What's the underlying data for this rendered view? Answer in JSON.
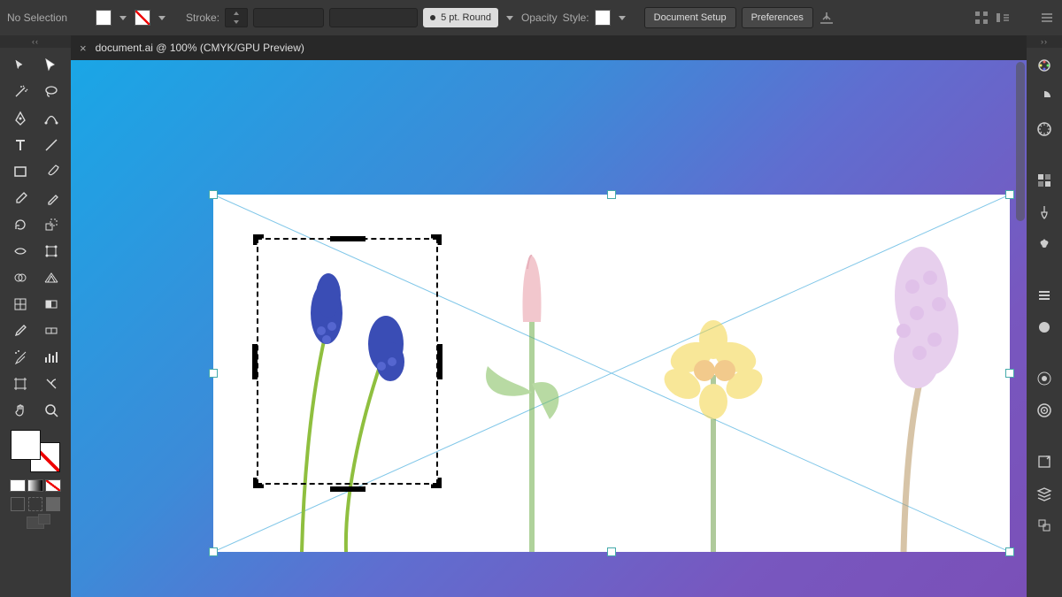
{
  "topbar": {
    "selection_label": "No Selection",
    "stroke_label": "Stroke:",
    "brush_label": "5 pt. Round",
    "opacity_label": "Opacity",
    "style_label": "Style:",
    "doc_setup_label": "Document Setup",
    "preferences_label": "Preferences"
  },
  "tab": {
    "title": "document.ai @ 100% (CMYK/GPU Preview)"
  },
  "colors": {
    "fill": "#ffffff",
    "stroke": "none",
    "canvas_gradient_start": "#1aa6e6",
    "canvas_gradient_end": "#7a50b8"
  },
  "left_tools": [
    "selection-tool",
    "direct-selection-tool",
    "magic-wand-tool",
    "lasso-tool",
    "pen-tool",
    "curvature-tool",
    "type-tool",
    "line-segment-tool",
    "rectangle-tool",
    "paintbrush-tool",
    "shaper-tool",
    "eraser-tool",
    "rotate-tool",
    "scale-tool",
    "width-tool",
    "free-transform-tool",
    "shape-builder-tool",
    "perspective-grid-tool",
    "mesh-tool",
    "gradient-tool",
    "eyedropper-tool",
    "blend-tool",
    "symbol-sprayer-tool",
    "column-graph-tool",
    "artboard-tool",
    "slice-tool",
    "hand-tool",
    "zoom-tool"
  ],
  "right_panels": [
    "color-panel",
    "color-guide-panel",
    "properties-panel",
    "swatches-panel",
    "brushes-panel",
    "symbols-panel",
    "stroke-panel",
    "align-panel",
    "transform-panel",
    "appearance-panel",
    "libraries-panel",
    "share-panel",
    "export-panel",
    "layers-panel",
    "asset-export-panel",
    "artboards-panel"
  ],
  "canvas": {
    "flowers": [
      "muscari",
      "tulip",
      "daffodil",
      "hyacinth"
    ]
  }
}
